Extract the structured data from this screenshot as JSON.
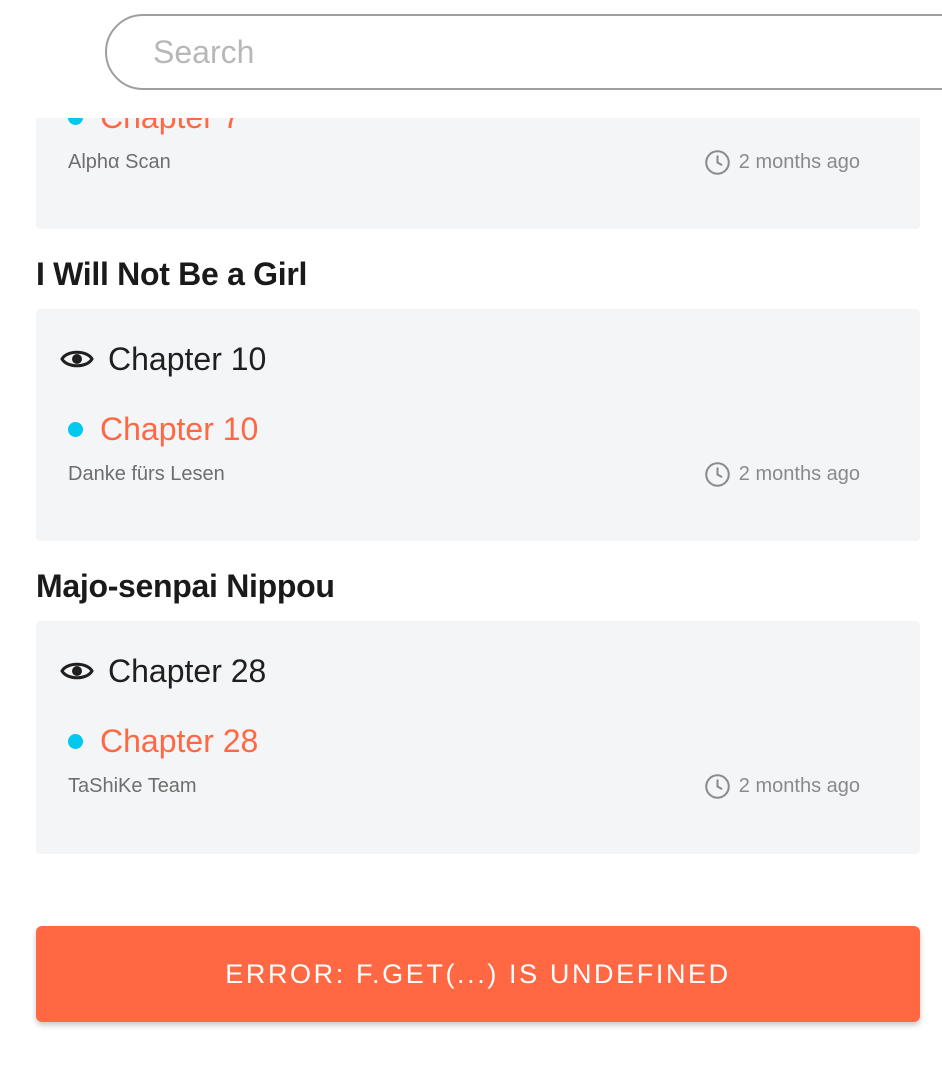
{
  "search": {
    "placeholder": "Search",
    "value": ""
  },
  "feed": {
    "entries": [
      {
        "series_title": "",
        "last_read": "",
        "chapter": "Chapter 7",
        "group": "Alphα Scan",
        "time": "2 months ago"
      },
      {
        "series_title": "I Will Not Be a Girl",
        "last_read": "Chapter 10",
        "chapter": "Chapter 10",
        "group": "Danke fürs Lesen",
        "time": "2 months ago"
      },
      {
        "series_title": "Majo-senpai Nippou",
        "last_read": "Chapter 28",
        "chapter": "Chapter 28",
        "group": "TaShiKe Team",
        "time": "2 months ago"
      }
    ]
  },
  "error": {
    "label": "Error: f.get(...) is undefined"
  },
  "icons": {
    "eye": "eye-icon",
    "clock": "clock-icon",
    "dot": "new-chapter-dot"
  },
  "colors": {
    "accent": "#ff6843",
    "dot": "#00c8ef",
    "card_bg": "#f4f5f7",
    "muted_text": "#6e6e6e"
  }
}
